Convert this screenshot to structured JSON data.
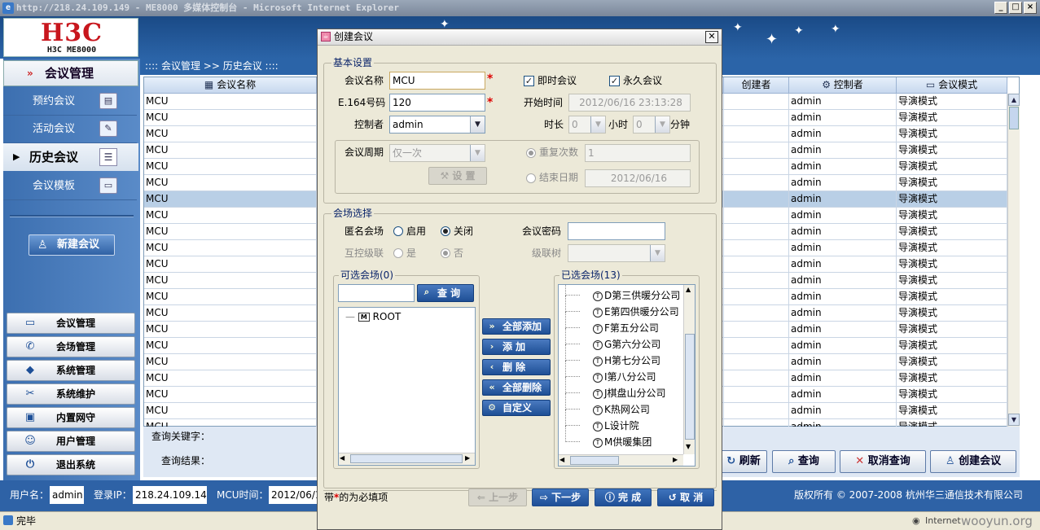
{
  "window": {
    "title": "http://218.24.109.149 - ME8000 多媒体控制台 - Microsoft Internet Explorer"
  },
  "logo": {
    "brand": "H3C",
    "model": "H3C ME8000"
  },
  "nav": {
    "section": "会议管理",
    "items": [
      "预约会议",
      "活动会议",
      "历史会议",
      "会议模板"
    ],
    "new_button": "新建会议",
    "bottom": [
      "会议管理",
      "会场管理",
      "系统管理",
      "系统维护",
      "内置网守",
      "用户管理",
      "退出系统"
    ]
  },
  "breadcrumb": ":::: 会议管理 >> 历史会议 ::::",
  "table": {
    "headers": {
      "name": "会议名称",
      "creator": "创建者",
      "controller": "控制者",
      "mode": "会议模式"
    },
    "row_name": "MCU",
    "row_controller": "admin",
    "row_mode": "导演模式",
    "row_count": 20,
    "selected_row": 6
  },
  "query": {
    "keyword_label": "查询关键字：",
    "result_label": "查询结果：",
    "refresh": "刷新",
    "search": "查询",
    "cancel_search": "取消查询",
    "create": "创建会议"
  },
  "status": {
    "user_label": "用户名：",
    "user": "admin",
    "ip_label": "登录IP：",
    "ip": "218.24.109.149",
    "mcu_label": "MCU时间：",
    "mcu_time": "2012/06/1",
    "copyright": "版权所有 © 2007-2008 杭州华三通信技术有限公司"
  },
  "ie_status": {
    "text": "完毕",
    "zone": "Internet",
    "watermark": "wooyun.org"
  },
  "dialog": {
    "title": "创建会议",
    "basic": {
      "legend": "基本设置",
      "name_label": "会议名称",
      "name_value": "MCU",
      "e164_label": "E.164号码",
      "e164_value": "120",
      "controller_label": "控制者",
      "controller_value": "admin",
      "instant_label": "即时会议",
      "instant_checked": true,
      "permanent_label": "永久会议",
      "permanent_checked": true,
      "start_label": "开始时间",
      "start_value": "2012/06/16 23:13:28",
      "duration_label": "时长",
      "hours_value": "0",
      "hours_unit": "小时",
      "minutes_value": "0",
      "minutes_unit": "分钟",
      "cycle_label": "会议周期",
      "cycle_value": "仅一次",
      "setup_button": "设 置",
      "repeat_label": "重复次数",
      "repeat_value": "1",
      "end_label": "结束日期",
      "end_value": "2012/06/16"
    },
    "site": {
      "legend": "会场选择",
      "anon_label": "匿名会场",
      "enable": "启用",
      "close": "关闭",
      "password_label": "会议密码",
      "cascade_label": "互控级联",
      "yes": "是",
      "no": "否",
      "tree_label": "级联树"
    },
    "available": {
      "legend": "可选会场(0)",
      "search_button": "查 询",
      "root": "ROOT"
    },
    "selected": {
      "legend": "已选会场(13)",
      "items": [
        "D第三供暖分公司",
        "E第四供暖分公司",
        "F第五分公司",
        "G第六分公司",
        "H第七分公司",
        "I第八分公司",
        "J棋盘山分公司",
        "K热网公司",
        "L设计院",
        "M供暖集团"
      ]
    },
    "mid_buttons": [
      "全部添加",
      "添 加",
      "删 除",
      "全部删除",
      "自定义"
    ],
    "required_prefix": "带",
    "required_star": "*",
    "required_suffix": "的为必填项",
    "footer": {
      "prev": "上一步",
      "next": "下一步",
      "finish": "完 成",
      "cancel": "取 消"
    }
  }
}
